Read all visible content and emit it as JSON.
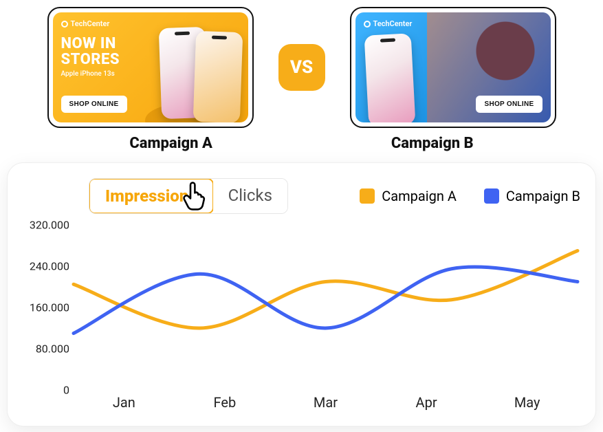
{
  "brand": "TechCenter",
  "ads": {
    "a": {
      "headline_line1": "NOW IN",
      "headline_line2": "STORES",
      "subline": "Apple iPhone 13s",
      "cta": "SHOP ONLINE",
      "label": "Campaign A"
    },
    "b": {
      "cta": "SHOP ONLINE",
      "label": "Campaign B"
    }
  },
  "vs_label": "VS",
  "tabs": {
    "impressions": "Impressions",
    "clicks": "Clicks",
    "active": "impressions"
  },
  "legend": {
    "a": "Campaign A",
    "b": "Campaign B"
  },
  "colors": {
    "a": "#f7ad19",
    "b": "#3f63f2"
  },
  "chart_data": {
    "type": "line",
    "xlabel": "",
    "ylabel": "",
    "categories": [
      "Jan",
      "Feb",
      "Mar",
      "Apr",
      "May"
    ],
    "y_ticks": [
      0,
      80000,
      160000,
      240000,
      320000
    ],
    "y_tick_labels": [
      "0",
      "80.000",
      "160.000",
      "240.000",
      "320.000"
    ],
    "ylim": [
      0,
      320000
    ],
    "series": [
      {
        "name": "Campaign A",
        "color": "#f7ad19",
        "values": [
          205000,
          120000,
          210000,
          175000,
          270000
        ]
      },
      {
        "name": "Campaign B",
        "color": "#3f63f2",
        "values": [
          110000,
          225000,
          120000,
          235000,
          210000
        ]
      }
    ]
  }
}
